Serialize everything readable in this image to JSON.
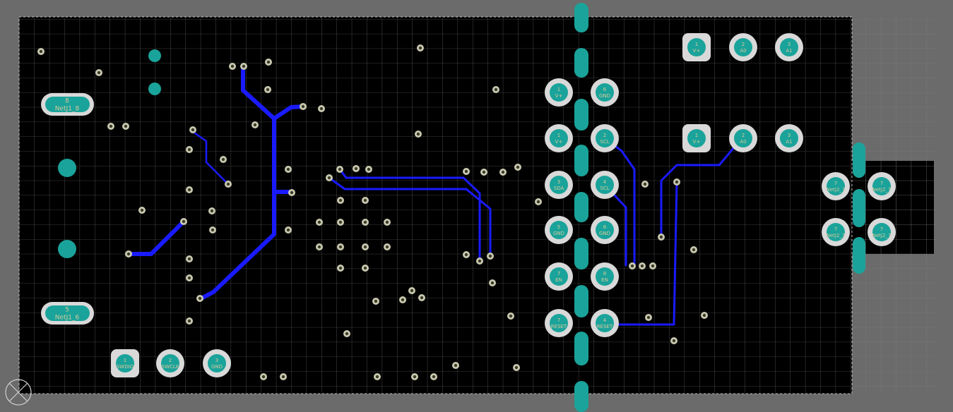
{
  "colors": {
    "background": "#6b6b6b",
    "board": "#000000",
    "grid": "#9a9a9a",
    "trace": "#1a1aff",
    "pad_ring": "#d9d9d9",
    "pad_fill": "#1aa39a",
    "via_ring": "#c9c9b0",
    "label": "#d8c89a"
  },
  "oval_pads": [
    {
      "num": "8",
      "net": "NetJ1_8"
    },
    {
      "num": "5",
      "net": "NetJ1_6"
    }
  ],
  "pads_bottom_left": [
    {
      "num": "1",
      "net": "SWDIO"
    },
    {
      "num": "2",
      "net": "SWCLK"
    },
    {
      "num": "3",
      "net": "GND"
    }
  ],
  "pads_top_right_row1": [
    {
      "num": "1",
      "net": "V+"
    },
    {
      "num": "2",
      "net": "A0"
    },
    {
      "num": "3",
      "net": "A1"
    }
  ],
  "pads_top_right_row2": [
    {
      "num": "1",
      "net": "V+"
    },
    {
      "num": "2",
      "net": "A0"
    },
    {
      "num": "3",
      "net": "A1"
    }
  ],
  "pads_connector_left": [
    {
      "num": "1",
      "net": "V+"
    },
    {
      "num": "1",
      "net": "V+"
    },
    {
      "num": "3",
      "net": "SDA"
    },
    {
      "num": "5",
      "net": "GND"
    },
    {
      "num": "7",
      "net": "EN"
    },
    {
      "num": "7",
      "net": "RESET"
    }
  ],
  "pads_connector_right": [
    {
      "num": "6",
      "net": "GND"
    },
    {
      "num": "2",
      "net": "SCL"
    },
    {
      "num": "4",
      "net": "SCL"
    },
    {
      "num": "6",
      "net": "GND"
    },
    {
      "num": "8",
      "net": "EN"
    },
    {
      "num": "4",
      "net": "RESET"
    }
  ],
  "pads_far_right": [
    {
      "num": "7",
      "net": "NetJ2_7"
    },
    {
      "num": "7",
      "net": "NetJ2_7"
    },
    {
      "num": "7",
      "net": "NetJ2_7"
    },
    {
      "num": "7",
      "net": "NetJ2_7"
    }
  ]
}
